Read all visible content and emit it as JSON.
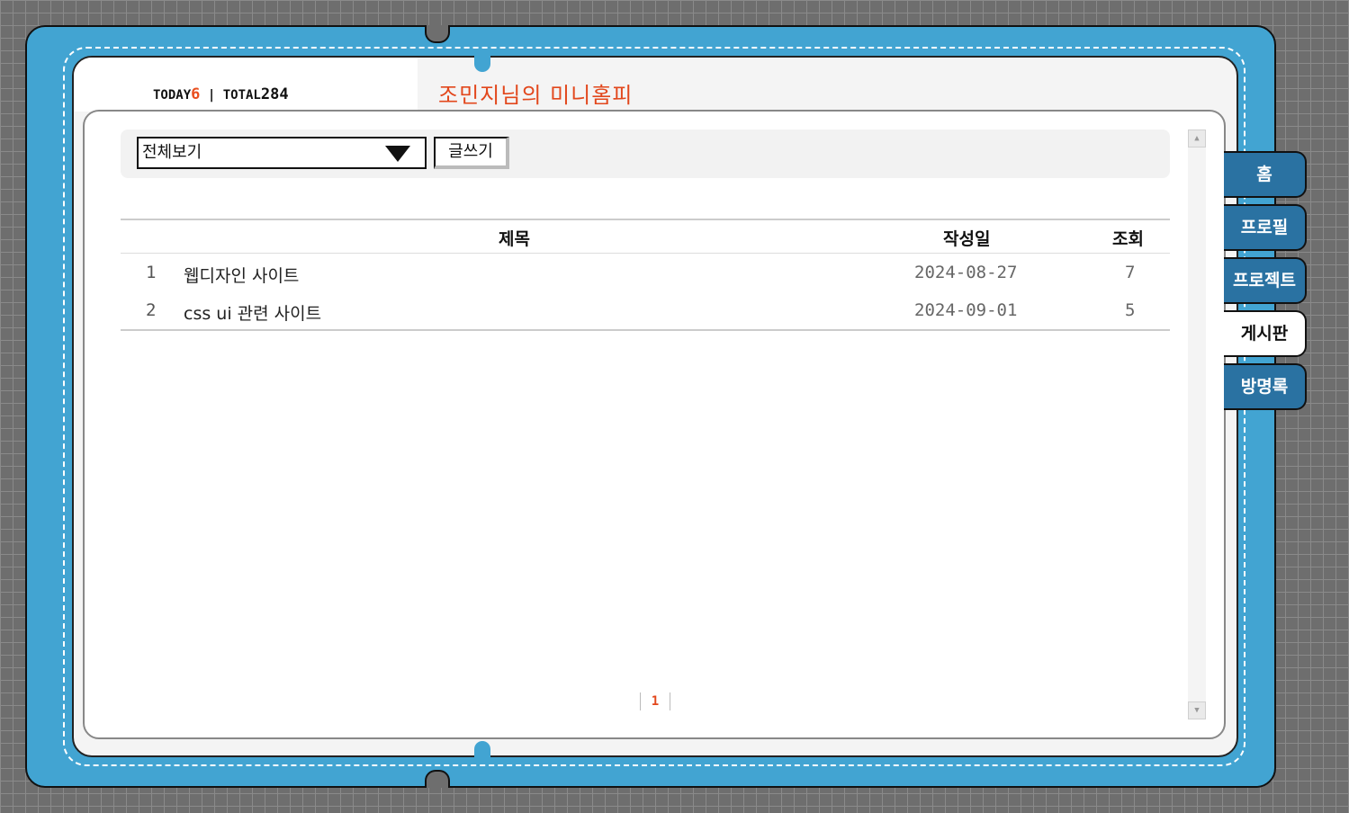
{
  "counter": {
    "today_label": "TODAY",
    "today_value": "6",
    "separator": "|",
    "total_label": "TOTAL",
    "total_value": "284"
  },
  "title": "조민지님의 미니홈피",
  "toolbar": {
    "select_value": "전체보기",
    "write_label": "글쓰기"
  },
  "table": {
    "headers": {
      "subject": "제목",
      "date": "작성일",
      "views": "조회"
    },
    "rows": [
      {
        "no": "1",
        "subject": "웹디자인 사이트",
        "date": "2024-08-27",
        "views": "7"
      },
      {
        "no": "2",
        "subject": "css ui 관련 사이트",
        "date": "2024-09-01",
        "views": "5"
      }
    ]
  },
  "pagination": {
    "current": "1"
  },
  "tabs": [
    {
      "label": "홈"
    },
    {
      "label": "프로필"
    },
    {
      "label": "프로젝트"
    },
    {
      "label": "게시판",
      "active": true
    },
    {
      "label": "방명록"
    }
  ],
  "colors": {
    "frame": "#42a4d2",
    "tab": "#2a72a2",
    "accent": "#e2471c"
  }
}
